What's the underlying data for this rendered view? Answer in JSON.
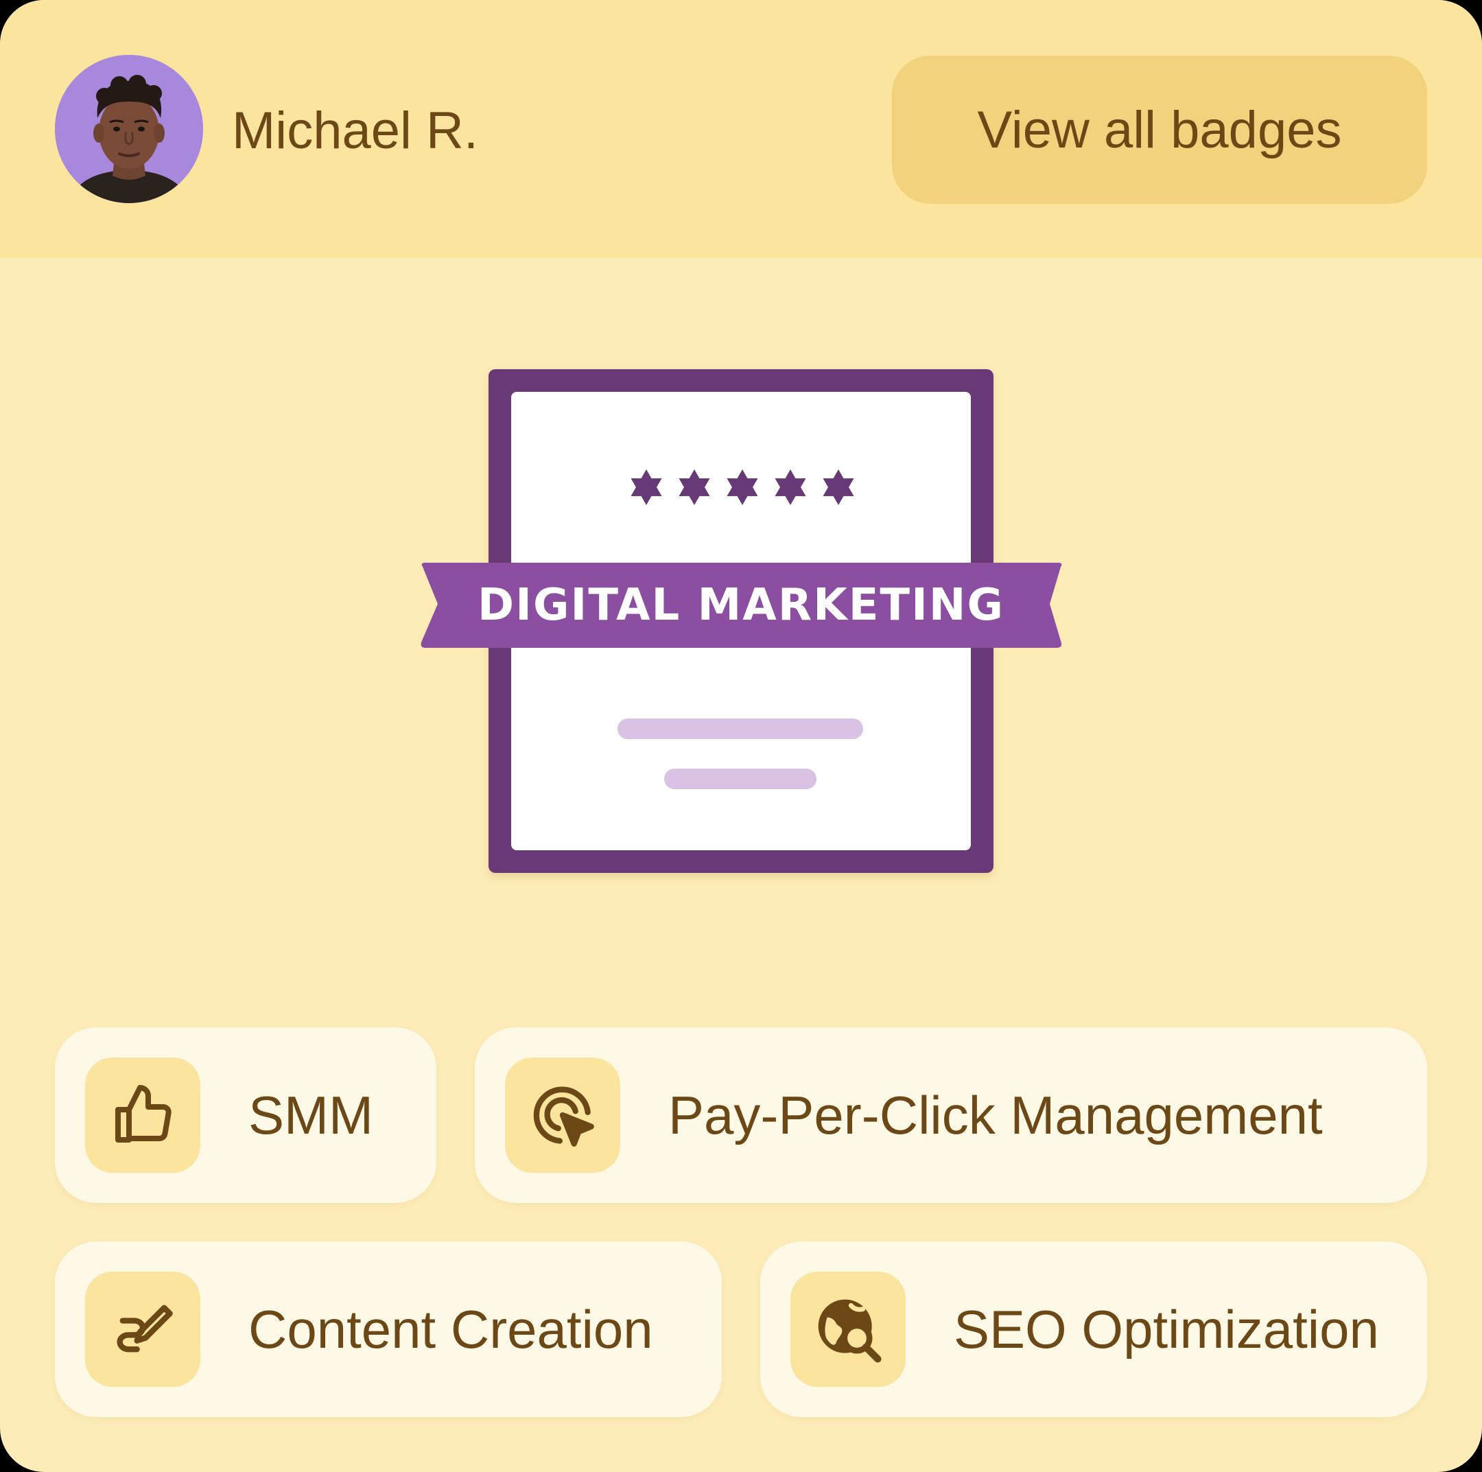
{
  "user": {
    "name": "Michael R."
  },
  "header": {
    "view_all_label": "View all badges"
  },
  "badge": {
    "title": "DIGITAL MARKETING",
    "rating": 5,
    "colors": {
      "frame": "#673977",
      "ribbon": "#8b4ea0",
      "ribbon_text": "#ffffff",
      "lines": "#d9c2e3"
    }
  },
  "skills": [
    {
      "label": "SMM",
      "icon": "thumbs-up-icon"
    },
    {
      "label": "Pay-Per-Click Management",
      "icon": "target-cursor-icon"
    },
    {
      "label": "Content Creation",
      "icon": "pen-scribble-icon"
    },
    {
      "label": "SEO Optimization",
      "icon": "globe-search-icon"
    }
  ],
  "colors": {
    "background": "#fdecb8",
    "header_bg": "#fae49e",
    "button_bg": "#f3d27d",
    "text": "#6b4816",
    "pill_bg": "#fef8e7",
    "avatar_bg": "#a888dc"
  }
}
